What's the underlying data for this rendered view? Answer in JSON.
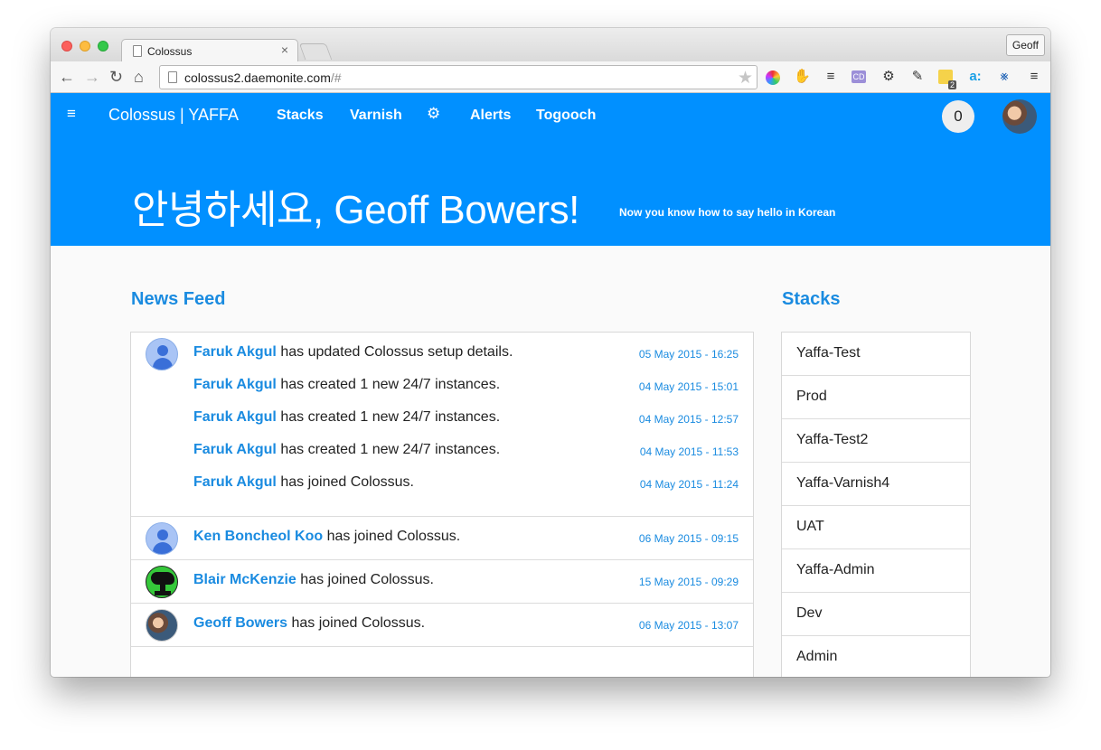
{
  "browser": {
    "tab_title": "Colossus",
    "tab_close": "×",
    "profile": "Geoff",
    "url_host": "colossus2.daemonite.com",
    "url_path": "/#",
    "extension_badge": "2"
  },
  "nav": {
    "brand": "Colossus | YAFFA",
    "links": [
      "Stacks",
      "Varnish",
      "Alerts",
      "Togooch"
    ],
    "notification_count": "0"
  },
  "hero": {
    "greeting": "안녕하세요, Geoff Bowers!",
    "subtitle": "Now you know how to say hello in Korean"
  },
  "news_feed": {
    "title": "News Feed",
    "groups": [
      {
        "avatar": "generic",
        "entries": [
          {
            "who": "Faruk Akgul",
            "action": "has updated Colossus setup details.",
            "date": "05 May 2015 - 16:25"
          },
          {
            "who": "Faruk Akgul",
            "action": "has created 1 new 24/7 instances.",
            "date": "04 May 2015 - 15:01"
          },
          {
            "who": "Faruk Akgul",
            "action": "has created 1 new 24/7 instances.",
            "date": "04 May 2015 - 12:57"
          },
          {
            "who": "Faruk Akgul",
            "action": "has created 1 new 24/7 instances.",
            "date": "04 May 2015 - 11:53"
          },
          {
            "who": "Faruk Akgul",
            "action": "has joined Colossus.",
            "date": "04 May 2015 - 11:24"
          }
        ]
      },
      {
        "avatar": "generic",
        "entries": [
          {
            "who": "Ken Boncheol Koo",
            "action": "has joined Colossus.",
            "date": "06 May 2015 - 09:15"
          }
        ]
      },
      {
        "avatar": "bonsai",
        "entries": [
          {
            "who": "Blair McKenzie",
            "action": "has joined Colossus.",
            "date": "15 May 2015 - 09:29"
          }
        ]
      },
      {
        "avatar": "photo",
        "entries": [
          {
            "who": "Geoff Bowers",
            "action": "has joined Colossus.",
            "date": "06 May 2015 - 13:07"
          }
        ]
      }
    ]
  },
  "stacks": {
    "title": "Stacks",
    "items": [
      "Yaffa-Test",
      "Prod",
      "Yaffa-Test2",
      "Yaffa-Varnish4",
      "UAT",
      "Yaffa-Admin",
      "Dev",
      "Admin"
    ]
  }
}
